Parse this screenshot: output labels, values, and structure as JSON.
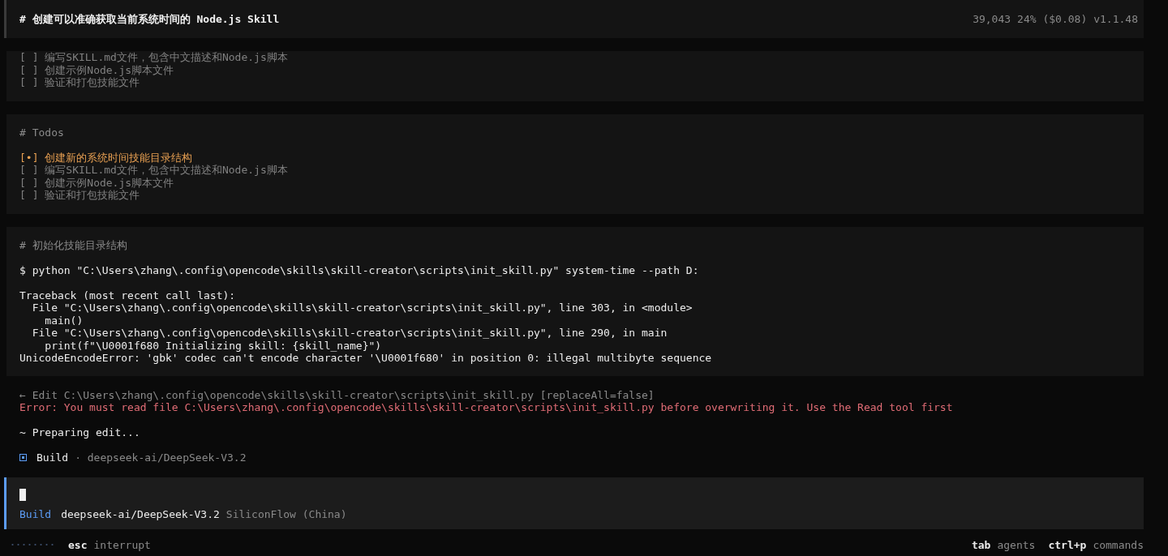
{
  "header": {
    "title": "# 创建可以准确获取当前系统时间的 Node.js Skill",
    "tokens": "39,043",
    "usage": "24% ($0.08)",
    "version": "v1.1.48"
  },
  "todo_partial": {
    "items": [
      {
        "marker": "[ ]",
        "text": "编写SKILL.md文件，包含中文描述和Node.js脚本",
        "active": false
      },
      {
        "marker": "[ ]",
        "text": "创建示例Node.js脚本文件",
        "active": false
      },
      {
        "marker": "[ ]",
        "text": "验证和打包技能文件",
        "active": false
      }
    ]
  },
  "todos": {
    "heading": "# Todos",
    "items": [
      {
        "marker": "[•]",
        "text": "创建新的系统时间技能目录结构",
        "active": true
      },
      {
        "marker": "[ ]",
        "text": "编写SKILL.md文件，包含中文描述和Node.js脚本",
        "active": false
      },
      {
        "marker": "[ ]",
        "text": "创建示例Node.js脚本文件",
        "active": false
      },
      {
        "marker": "[ ]",
        "text": "验证和打包技能文件",
        "active": false
      }
    ]
  },
  "command": {
    "heading": "# 初始化技能目录结构",
    "command": "$ python \"C:\\Users\\zhang\\.config\\opencode\\skills\\skill-creator\\scripts\\init_skill.py\" system-time --path D:",
    "output": [
      "Traceback (most recent call last):",
      "  File \"C:\\Users\\zhang\\.config\\opencode\\skills\\skill-creator\\scripts\\init_skill.py\", line 303, in <module>",
      "    main()",
      "  File \"C:\\Users\\zhang\\.config\\opencode\\skills\\skill-creator\\scripts\\init_skill.py\", line 290, in main",
      "    print(f\"\\U0001f680 Initializing skill: {skill_name}\")",
      "UnicodeEncodeError: 'gbk' codec can't encode character '\\U0001f680' in position 0: illegal multibyte sequence"
    ]
  },
  "edit": {
    "line": "← Edit C:\\Users\\zhang\\.config\\opencode\\skills\\skill-creator\\scripts\\init_skill.py [replaceAll=false]",
    "error": "Error: You must read file C:\\Users\\zhang\\.config\\opencode\\skills\\skill-creator\\scripts\\init_skill.py before overwriting it. Use the Read tool first"
  },
  "status": "~ Preparing edit...",
  "agent_line": {
    "agent": "Build",
    "model": "· deepseek-ai/DeepSeek-V3.2"
  },
  "prompt": {
    "agent": "Build",
    "model": "deepseek-ai/DeepSeek-V3.2",
    "provider": "SiliconFlow (China)"
  },
  "footer": {
    "left": [
      {
        "key": "esc",
        "label": "interrupt"
      }
    ],
    "right": [
      {
        "key": "tab",
        "label": "agents"
      },
      {
        "key": "ctrl+p",
        "label": "commands"
      }
    ]
  }
}
